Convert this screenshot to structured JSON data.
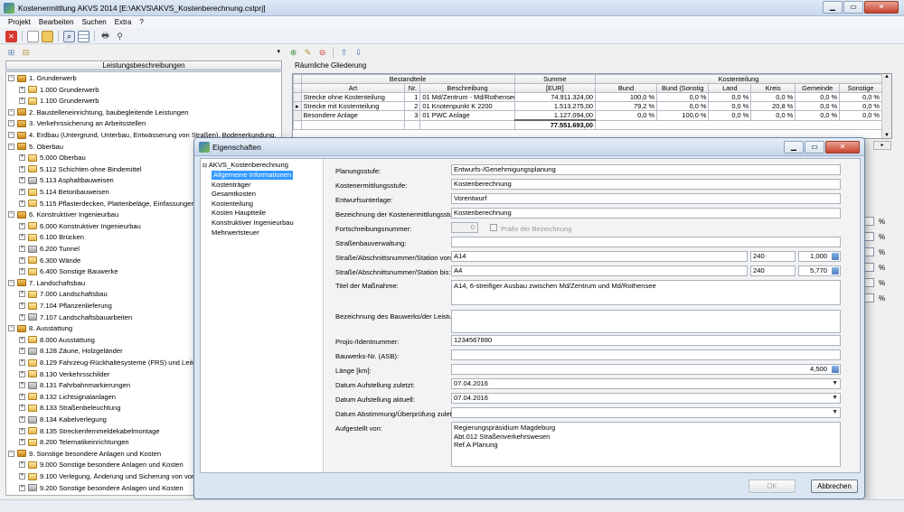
{
  "app": {
    "title": "Kostenermittlung AKVS 2014 [E:\\AKVS\\AKVS_Kostenberechnung.cstprj]"
  },
  "menu": [
    "Projekt",
    "Bearbeiten",
    "Suchen",
    "Extra",
    "?"
  ],
  "left": {
    "header": "Leistungsbeschreibungen",
    "tree": [
      {
        "level": 0,
        "label": "1. Grunderwerb",
        "icon": "category"
      },
      {
        "level": 1,
        "label": "1.000 Grunderwerb",
        "icon": "item"
      },
      {
        "level": 1,
        "label": "1.100 Grunderwerb",
        "icon": "item"
      },
      {
        "level": 0,
        "label": "2. Baustelleneinrichtung, baubegleitende Leistungen",
        "icon": "category"
      },
      {
        "level": 0,
        "label": "3. Verkehrssicherung an Arbeitsstellen",
        "icon": "category"
      },
      {
        "level": 0,
        "label": "4. Erdbau (Untergrund, Unterbau, Entwässerung von Straßen), Bodenerkundung,",
        "icon": "category"
      },
      {
        "level": 0,
        "label": "5. Oberbau",
        "icon": "category"
      },
      {
        "level": 1,
        "label": "5.000 Oberbau",
        "icon": "item"
      },
      {
        "level": 1,
        "label": "5.112 Schichten ohne Bindemittel",
        "icon": "item"
      },
      {
        "level": 1,
        "label": "5.113 Asphaltbauweisen",
        "icon": "item"
      },
      {
        "level": 1,
        "label": "5.114 Betonbauweisen",
        "icon": "item"
      },
      {
        "level": 1,
        "label": "5.115 Pflasterdecken, Plattenbeläge, Einfassungen",
        "icon": "item"
      },
      {
        "level": 0,
        "label": "6. Konstruktiver Ingenieurbau",
        "icon": "category"
      },
      {
        "level": 1,
        "label": "6.000 Konstruktiver Ingenieurbau",
        "icon": "item"
      },
      {
        "level": 1,
        "label": "6.100 Brücken",
        "icon": "item"
      },
      {
        "level": 1,
        "label": "6.200 Tunnel",
        "icon": "item"
      },
      {
        "level": 1,
        "label": "6.300 Wände",
        "icon": "item"
      },
      {
        "level": 1,
        "label": "6.400 Sonstige Bauwerke",
        "icon": "item"
      },
      {
        "level": 0,
        "label": "7. Landschaftsbau",
        "icon": "category"
      },
      {
        "level": 1,
        "label": "7.000 Landschaftsbau",
        "icon": "item"
      },
      {
        "level": 1,
        "label": "7.104 Pflanzenlieferung",
        "icon": "item"
      },
      {
        "level": 1,
        "label": "7.107 Landschaftsbauarbeiten",
        "icon": "item"
      },
      {
        "level": 0,
        "label": "8. Ausstattung",
        "icon": "category"
      },
      {
        "level": 1,
        "label": "8.000 Ausstattung",
        "icon": "item"
      },
      {
        "level": 1,
        "label": "8.128 Zäune, Holzgeländer",
        "icon": "item"
      },
      {
        "level": 1,
        "label": "8.129 Fahrzeug-Rückhaltesysteme (FRS) und Leiteinrich",
        "icon": "item"
      },
      {
        "level": 1,
        "label": "8.130 Verkehrsschilder",
        "icon": "item"
      },
      {
        "level": 1,
        "label": "8.131 Fahrbahnmarkierungen",
        "icon": "item"
      },
      {
        "level": 1,
        "label": "8.132 Lichtsignalanlagen",
        "icon": "item"
      },
      {
        "level": 1,
        "label": "8.133 Straßenbeleuchtung",
        "icon": "item"
      },
      {
        "level": 1,
        "label": "8.134 Kabelverlegung",
        "icon": "item"
      },
      {
        "level": 1,
        "label": "8.135 Streckenfernmeldekabelmontage",
        "icon": "item"
      },
      {
        "level": 1,
        "label": "8.200 Telematikeinrichtungen",
        "icon": "item"
      },
      {
        "level": 0,
        "label": "9. Sonstige besondere Anlagen und Kosten",
        "icon": "category"
      },
      {
        "level": 1,
        "label": "9.000 Sonstige besondere Anlagen und Kosten",
        "icon": "item"
      },
      {
        "level": 1,
        "label": "9.100 Verlegung, Änderung und Sicherung von vorh. Ve",
        "icon": "item"
      },
      {
        "level": 1,
        "label": "9.200 Sonstige besondere Anlagen und Kosten",
        "icon": "item"
      }
    ]
  },
  "right": {
    "section_label": "Räumliche Gliederung",
    "group_headers": {
      "bestandteile": "Bestandteile",
      "summe": "Summe",
      "kostenteilung": "Kostenteilung"
    },
    "columns": [
      "Art",
      "Nr.",
      "Beschreibung",
      "[EUR]",
      "Bund",
      "Bund (Sonstig",
      "Land",
      "Kreis",
      "Gemeinde",
      "Sonstige"
    ],
    "rows": [
      {
        "art": "Strecke ohne Kostenteilung",
        "nr": "1",
        "beschreibung": "01 Md/Zentrum - Md/Rothensee",
        "summe": "74.911.324,00",
        "bund": "100,0 %",
        "bund_sonstig": "0,0 %",
        "land": "0,0 %",
        "kreis": "0,0 %",
        "gemeinde": "0,0 %",
        "sonstige": "0,0 %"
      },
      {
        "art": "Strecke mit Kostenteilung",
        "nr": "2",
        "beschreibung": "01 Knotenpunkt K 2200",
        "summe": "1.513.275,00",
        "bund": "79,2 %",
        "bund_sonstig": "0,0 %",
        "land": "0,0 %",
        "kreis": "20,8 %",
        "gemeinde": "0,0 %",
        "sonstige": "0,0 %"
      },
      {
        "art": "Besondere Anlage",
        "nr": "3",
        "beschreibung": "01 PWC Anlage",
        "summe": "1.127.094,00",
        "bund": "0,0 %",
        "bund_sonstig": "100,0 %",
        "land": "0,0 %",
        "kreis": "0,0 %",
        "gemeinde": "0,0 %",
        "sonstige": "0,0 %"
      }
    ],
    "total": "77.551.693,00",
    "side_percent": [
      "%",
      "%",
      "%",
      "%",
      "%",
      "%"
    ]
  },
  "dialog": {
    "title": "Eigenschaften",
    "nav_root": "AKVS_Kostenberechnung",
    "nav_items": [
      "Allgemeine Informationen",
      "Kostenträger",
      "Gesamtkosten",
      "Kostenteilung",
      "Kosten Hauptteile",
      "Konstruktiver Ingenieurbau",
      "Mehrwertsteuer"
    ],
    "fields": {
      "planungsstufe": {
        "label": "Planungsstufe:",
        "value": "Entwurfs-/Genehmigungsplanung"
      },
      "kostenermittlungsstufe": {
        "label": "Kostenermittlungsstufe:",
        "value": "Kostenberechnung"
      },
      "entwurfsunterlage": {
        "label": "Entwurfsunterlage:",
        "value": "Vorentwurf"
      },
      "bezeichnung_kes": {
        "label": "Bezeichnung der Kostenermittlungsstufe:",
        "value": "Kostenberechnung"
      },
      "fortschreibung": {
        "label": "Fortschreibungsnummer:",
        "value": "0",
        "checkbox": "Präfix der Bezeichnung"
      },
      "strassenbauverwaltung": {
        "label": "Straßenbauverwaltung:",
        "value": ""
      },
      "station_von": {
        "label": "Straße/Abschnittsnummer/Station von:",
        "strasse": "A14",
        "abschnitt": "240",
        "station": "1,000"
      },
      "station_bis": {
        "label": "Straße/Abschnittsnummer/Station bis:",
        "strasse": "A4",
        "abschnitt": "240",
        "station": "5,770"
      },
      "titel": {
        "label": "Titel der Maßnahme:",
        "value": "A14, 6-streifiger Ausbau zwischen Md/Zentrum und Md/Rothensee"
      },
      "bauwerk": {
        "label": "Bezeichnung des Bauwerks/der Leistung:",
        "value": ""
      },
      "projis": {
        "label": "Projis-/Identnummer:",
        "value": "1234567890"
      },
      "asb": {
        "label": "Bauwerks-Nr. (ASB):",
        "value": ""
      },
      "laenge": {
        "label": "Länge [km]:",
        "value": "4,500"
      },
      "datum_zuletzt": {
        "label": "Datum Aufstellung zuletzt:",
        "value": "07.04.2016"
      },
      "datum_aktuell": {
        "label": "Datum Aufstellung aktuell:",
        "value": "07.04.2016"
      },
      "datum_abstimmung": {
        "label": "Datum Abstimmung/Überprüfung zuletzt:",
        "value": ""
      },
      "aufgestellt": {
        "label": "Aufgestellt von:",
        "lines": [
          "Regierungspräsidium Magdeburg",
          "Abt.012 Straßenverkehrswesen",
          "Ref.A Planung"
        ]
      }
    },
    "buttons": {
      "ok": "OK",
      "cancel": "Abbrechen"
    }
  }
}
